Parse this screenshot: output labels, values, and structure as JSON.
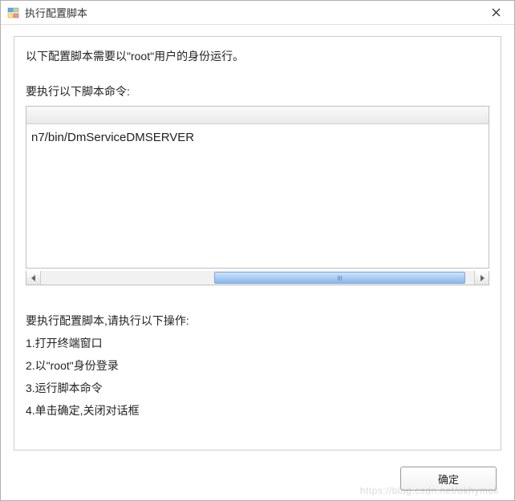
{
  "window": {
    "title": "执行配置脚本"
  },
  "content": {
    "intro": "以下配置脚本需要以\"root\"用户的身份运行。",
    "script_label": "要执行以下脚本命令:",
    "script_text": "n7/bin/DmServiceDMSERVER",
    "instructions_heading": "要执行配置脚本,请执行以下操作:",
    "steps": {
      "s1": "1.打开终端窗口",
      "s2": "2.以\"root\"身份登录",
      "s3": "3.运行脚本命令",
      "s4": "4.单击确定,关闭对话框"
    }
  },
  "buttons": {
    "ok": "确定"
  },
  "watermark": "https://blog.csdn.net/okhymok"
}
